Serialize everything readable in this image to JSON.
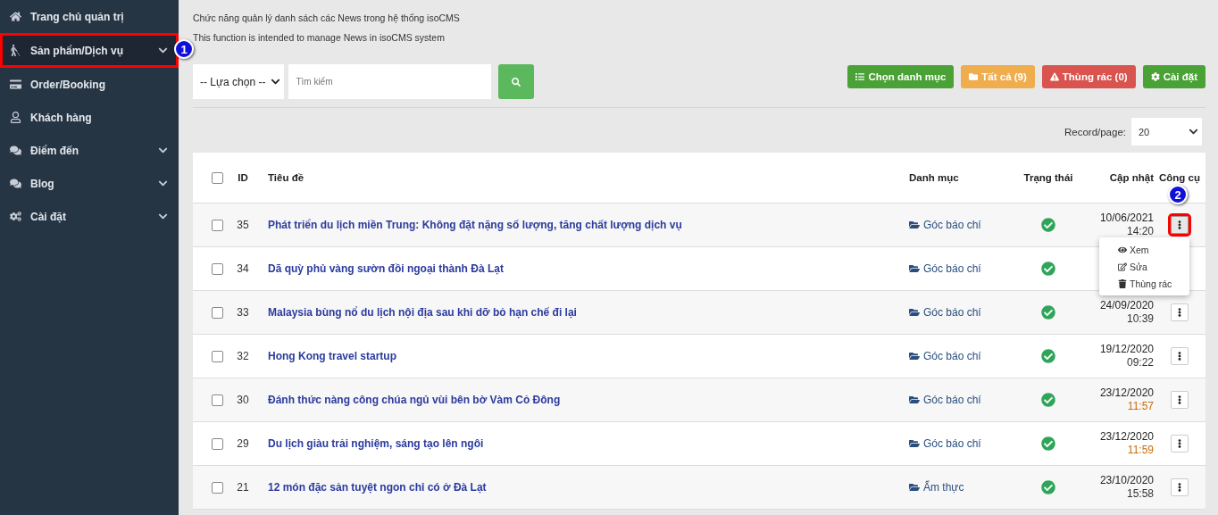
{
  "sidebar": {
    "items": [
      {
        "label": "Trang chủ quản trị",
        "kind": "home",
        "expandable": false,
        "selected": false
      },
      {
        "label": "Sản phẩm/Dịch vụ",
        "kind": "products",
        "expandable": true,
        "selected": true,
        "callout": "1"
      },
      {
        "label": "Order/Booking",
        "kind": "orders",
        "expandable": false,
        "selected": false
      },
      {
        "label": "Khách hàng",
        "kind": "customers",
        "expandable": false,
        "selected": false
      },
      {
        "label": "Điểm đến",
        "kind": "destinations",
        "expandable": true,
        "selected": false
      },
      {
        "label": "Blog",
        "kind": "blog",
        "expandable": true,
        "selected": false
      },
      {
        "label": "Cài đặt",
        "kind": "settings",
        "expandable": true,
        "selected": false
      }
    ]
  },
  "description": [
    "Chức năng quản lý danh sách các News trong hệ thống isoCMS",
    "This function is intended to manage News in isoCMS system"
  ],
  "filter": {
    "select": "-- Lựa chọn --",
    "search_placeholder": "Tìm kiếm"
  },
  "actions": [
    {
      "label": "Chọn danh mục",
      "kind": "category"
    },
    {
      "label": "Tất cả (9)",
      "kind": "all"
    },
    {
      "label": "Thùng rác (0)",
      "kind": "trash"
    },
    {
      "label": "Cài đặt",
      "kind": "settings"
    }
  ],
  "records_per_page": {
    "label": "Record/page:",
    "value": "20"
  },
  "table": {
    "select_all_checked": false,
    "columns": [
      "ID",
      "Tiêu đề",
      "Danh mục",
      "Trạng thái",
      "Cập nhật",
      "Công cụ"
    ],
    "rows": [
      {
        "checked": false,
        "id": "35",
        "title": "Phát triển du lịch miền Trung: Không đặt nặng số lượng, tăng chất lượng dịch vụ",
        "category": "Góc báo chí",
        "published": true,
        "date": "10/06/2021",
        "time": {
          "text": "14:20",
          "color": "#333333"
        },
        "menu_open": true,
        "callout": "2"
      },
      {
        "checked": false,
        "id": "34",
        "title": "Dã quỳ phủ vàng sườn đồi ngoại thành Đà Lạt",
        "category": "Góc báo chí",
        "published": true,
        "covered": true,
        "menu_open": false
      },
      {
        "checked": false,
        "id": "33",
        "title": "Malaysia bùng nổ du lịch nội địa sau khi dỡ bỏ hạn chế đi lại",
        "category": "Góc báo chí",
        "published": true,
        "date": "24/09/2020",
        "time": {
          "text": "10:39",
          "color": "#333333"
        },
        "menu_open": false
      },
      {
        "checked": false,
        "id": "32",
        "title": "Hong Kong travel startup",
        "category": "Góc báo chí",
        "published": true,
        "date": "19/12/2020",
        "time": {
          "text": "09:22",
          "color": "#333333"
        },
        "menu_open": false
      },
      {
        "checked": false,
        "id": "30",
        "title": "Đánh thức nàng công chúa ngủ vùi bên bờ Vàm Cỏ Đông",
        "category": "Góc báo chí",
        "published": true,
        "date": "23/12/2020",
        "time": {
          "text": "11:57",
          "color": "#c86d0a"
        },
        "menu_open": false
      },
      {
        "checked": false,
        "id": "29",
        "title": "Du lịch giàu trải nghiệm, sáng tạo lên ngôi",
        "category": "Góc báo chí",
        "published": true,
        "date": "23/12/2020",
        "time": {
          "text": "11:59",
          "color": "#c86d0a"
        },
        "menu_open": false
      },
      {
        "checked": false,
        "id": "21",
        "title": "12 món đặc sản tuyệt ngon chỉ có ở Đà Lạt",
        "category": "Ẩm thực",
        "published": true,
        "date": "23/10/2020",
        "time": {
          "text": "15:58",
          "color": "#333333"
        },
        "menu_open": false
      }
    ]
  },
  "row_menu": [
    {
      "label": "Xem",
      "kind": "view"
    },
    {
      "label": "Sửa",
      "kind": "edit"
    },
    {
      "label": "Thùng rác",
      "kind": "trash"
    }
  ]
}
